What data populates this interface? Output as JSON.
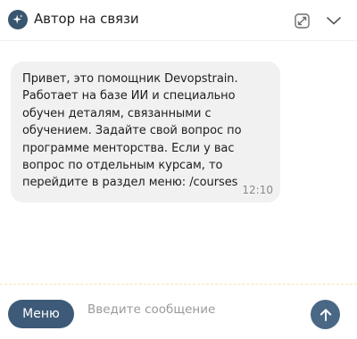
{
  "header": {
    "title": "Автор на связи",
    "avatar_icon": "sparkle-icon",
    "expand_icon": "expand-icon",
    "collapse_icon": "chevron-down-icon"
  },
  "messages": [
    {
      "text": "Привет, это помощник Devopstrain.\nРаботает на базе ИИ и специально\nобучен деталям, связанными с\nобучением. Задайте свой вопрос по\nпрограмме менторства. Если у вас\nвопрос по отдельным курсам, то\nперейдите в раздел меню: /courses",
      "time": "12:10"
    }
  ],
  "composer": {
    "menu_label": "Меню",
    "input_placeholder": "Введите сообщение",
    "input_value": "",
    "send_icon": "arrow-up-icon"
  },
  "colors": {
    "accent": "#3d5a78",
    "bubble_bg": "#f1f1f2",
    "divider": "#f3e8b0"
  }
}
